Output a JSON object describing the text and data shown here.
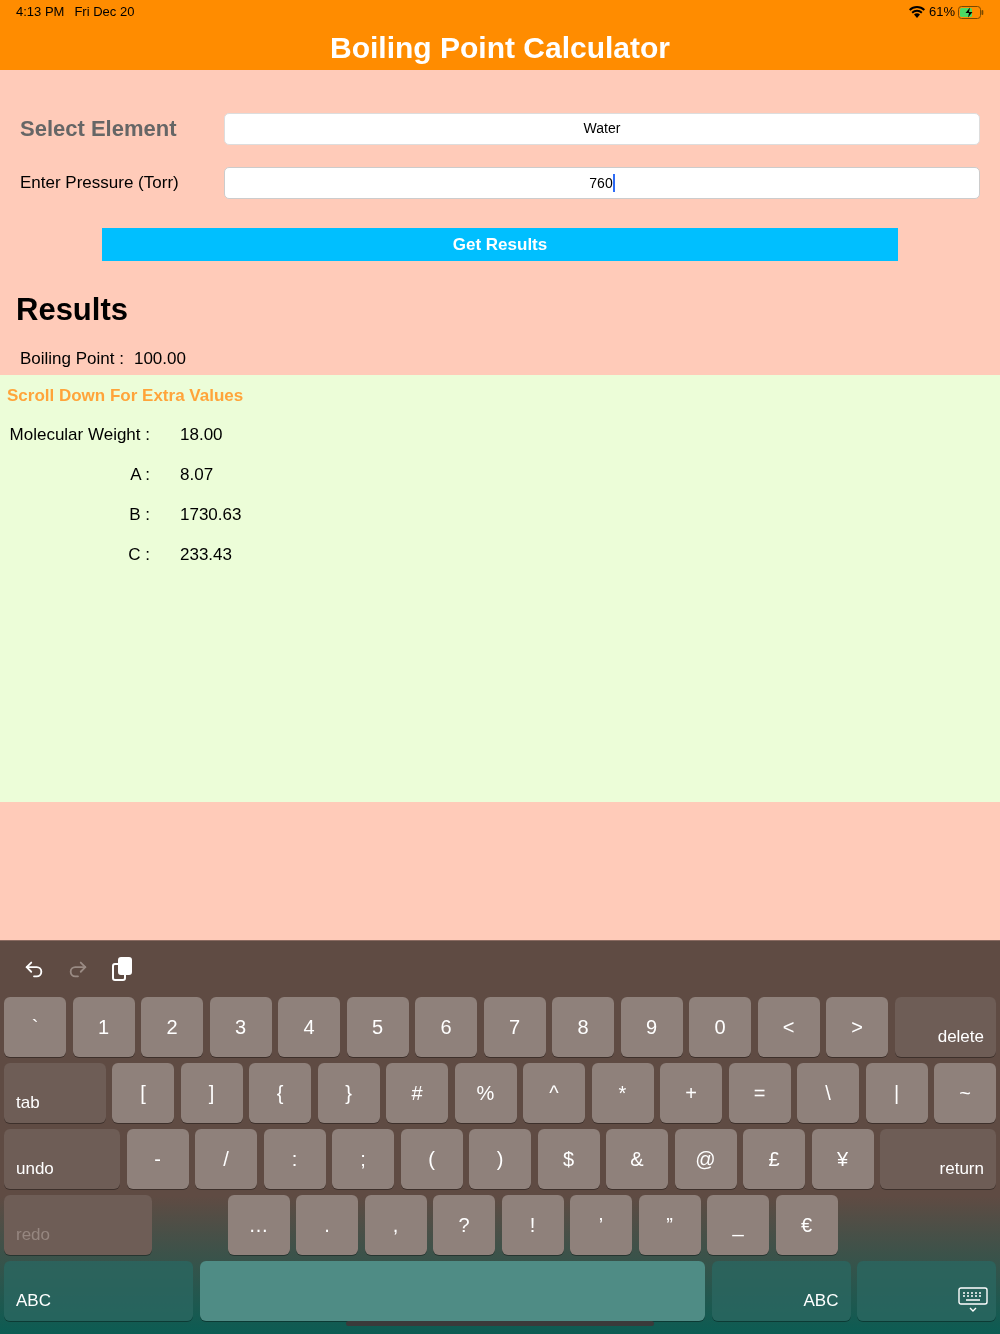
{
  "status_bar": {
    "time": "4:13 PM",
    "date": "Fri Dec 20",
    "battery": "61%",
    "charging": true
  },
  "title": "Boiling Point Calculator",
  "form": {
    "element_label": "Select Element",
    "element_value": "Water",
    "pressure_label": "Enter Pressure (Torr)",
    "pressure_value": "760",
    "pressure_focused": true,
    "button": "Get Results"
  },
  "results": {
    "heading": "Results",
    "items": [
      {
        "label": "Boiling Point :",
        "value": "100.00"
      }
    ]
  },
  "extra": {
    "hint": "Scroll Down For Extra Values",
    "items": [
      {
        "label": "Molecular Weight :",
        "value": "18.00"
      },
      {
        "label": "A :",
        "value": "8.07"
      },
      {
        "label": "B :",
        "value": "1730.63"
      },
      {
        "label": "C :",
        "value": "233.43"
      }
    ]
  },
  "keyboard": {
    "toolbar": [
      {
        "kind": "undo",
        "disabled": false
      },
      {
        "kind": "redo",
        "disabled": true
      },
      {
        "kind": "paste",
        "disabled": false
      }
    ],
    "rows": [
      {
        "keys": [
          {
            "kind": "char",
            "label": "`"
          },
          {
            "kind": "char",
            "label": "1"
          },
          {
            "kind": "char",
            "label": "2"
          },
          {
            "kind": "char",
            "label": "3"
          },
          {
            "kind": "char",
            "label": "4"
          },
          {
            "kind": "char",
            "label": "5"
          },
          {
            "kind": "char",
            "label": "6"
          },
          {
            "kind": "char",
            "label": "7"
          },
          {
            "kind": "char",
            "label": "8"
          },
          {
            "kind": "char",
            "label": "9"
          },
          {
            "kind": "char",
            "label": "0"
          },
          {
            "kind": "char",
            "label": "<"
          },
          {
            "kind": "char",
            "label": ">"
          },
          {
            "kind": "right",
            "label": "delete",
            "disabled": false
          }
        ]
      },
      {
        "keys": [
          {
            "kind": "left",
            "label": "tab",
            "disabled": false
          },
          {
            "kind": "char",
            "label": "["
          },
          {
            "kind": "char",
            "label": "]"
          },
          {
            "kind": "char",
            "label": "{"
          },
          {
            "kind": "char",
            "label": "}"
          },
          {
            "kind": "char",
            "label": "#"
          },
          {
            "kind": "char",
            "label": "%"
          },
          {
            "kind": "char",
            "label": "^"
          },
          {
            "kind": "char",
            "label": "*"
          },
          {
            "kind": "char",
            "label": "+"
          },
          {
            "kind": "char",
            "label": "="
          },
          {
            "kind": "char",
            "label": "\\"
          },
          {
            "kind": "char",
            "label": "|"
          },
          {
            "kind": "char",
            "label": "~"
          }
        ]
      },
      {
        "keys": [
          {
            "kind": "left",
            "label": "undo",
            "disabled": false
          },
          {
            "kind": "char",
            "label": "-"
          },
          {
            "kind": "char",
            "label": "/"
          },
          {
            "kind": "char",
            "label": ":"
          },
          {
            "kind": "char",
            "label": ";"
          },
          {
            "kind": "char",
            "label": "("
          },
          {
            "kind": "char",
            "label": ")"
          },
          {
            "kind": "char",
            "label": "$"
          },
          {
            "kind": "char",
            "label": "&"
          },
          {
            "kind": "char",
            "label": "@"
          },
          {
            "kind": "char",
            "label": "£"
          },
          {
            "kind": "char",
            "label": "¥"
          },
          {
            "kind": "right",
            "label": "return",
            "disabled": false
          }
        ]
      },
      {
        "keys": [
          {
            "kind": "left",
            "label": "redo",
            "disabled": true
          },
          {
            "kind": "char",
            "label": "…"
          },
          {
            "kind": "char",
            "label": "."
          },
          {
            "kind": "char",
            "label": ","
          },
          {
            "kind": "char",
            "label": "?"
          },
          {
            "kind": "char",
            "label": "!"
          },
          {
            "kind": "char",
            "label": "’"
          },
          {
            "kind": "char",
            "label": "”"
          },
          {
            "kind": "char",
            "label": "_"
          },
          {
            "kind": "char",
            "label": "€"
          }
        ]
      },
      {
        "keys": [
          {
            "kind": "mode-left",
            "label": "ABC"
          },
          {
            "kind": "space"
          },
          {
            "kind": "mode-right",
            "label": "ABC"
          },
          {
            "kind": "dismiss"
          }
        ]
      }
    ]
  }
}
